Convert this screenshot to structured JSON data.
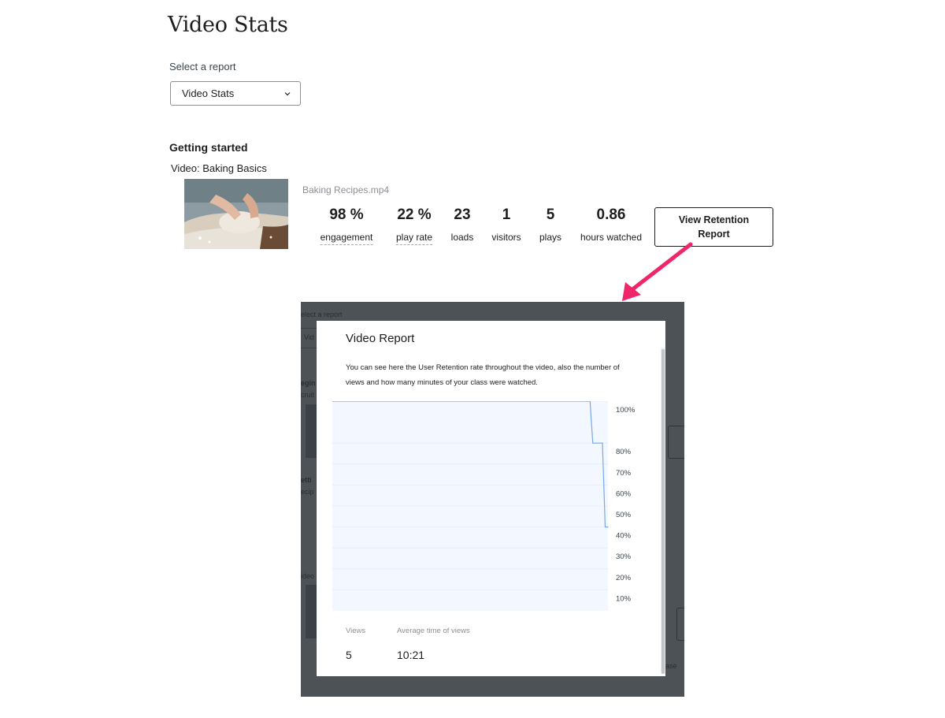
{
  "page": {
    "title": "Video Stats"
  },
  "report_select": {
    "label": "Select a report",
    "selected": "Video Stats"
  },
  "section": {
    "title": "Getting started",
    "video_title": "Video: Baking Basics",
    "file_name": "Baking Recipes.mp4"
  },
  "stats": [
    {
      "value": "98 %",
      "label": "engagement"
    },
    {
      "value": "22 %",
      "label": "play rate"
    },
    {
      "value": "23",
      "label": "loads"
    },
    {
      "value": "1",
      "label": "visitors"
    },
    {
      "value": "5",
      "label": "plays"
    },
    {
      "value": "0.86",
      "label": "hours watched"
    }
  ],
  "retention_button": {
    "label": "View Retention Report"
  },
  "colors": {
    "arrow": "#f0266d",
    "chart_line": "#7aa7e8",
    "chart_fill": "#f3f7ff",
    "overlay": "#4d5256"
  },
  "inset": {
    "background_fragments": [
      "elect a report",
      "Vid",
      "egin",
      "cruit",
      "etti",
      "ecip",
      "ideo",
      "ase"
    ],
    "modal": {
      "title": "Video Report",
      "description": "You can see here the User Retention rate throughout the video, also the number of views and how many minutes of your class were watched.",
      "views_label": "Views",
      "views_value": "5",
      "avg_label": "Average time of views",
      "avg_value": "10:21"
    }
  },
  "chart_data": {
    "type": "area",
    "title": "",
    "xlabel": "",
    "ylabel": "",
    "y_ticks": [
      "100%",
      "80%",
      "70%",
      "60%",
      "50%",
      "40%",
      "30%",
      "20%",
      "10%"
    ],
    "y_tick_values": [
      100,
      80,
      70,
      60,
      50,
      40,
      30,
      20,
      10
    ],
    "ylim": [
      0,
      100
    ],
    "x_range": [
      0,
      1
    ],
    "grid": true,
    "series": [
      {
        "points": [
          [
            0,
            100
          ],
          [
            0.935,
            100
          ],
          [
            0.945,
            80
          ],
          [
            0.98,
            80
          ],
          [
            0.99,
            40
          ],
          [
            1.0,
            40
          ]
        ]
      }
    ]
  }
}
